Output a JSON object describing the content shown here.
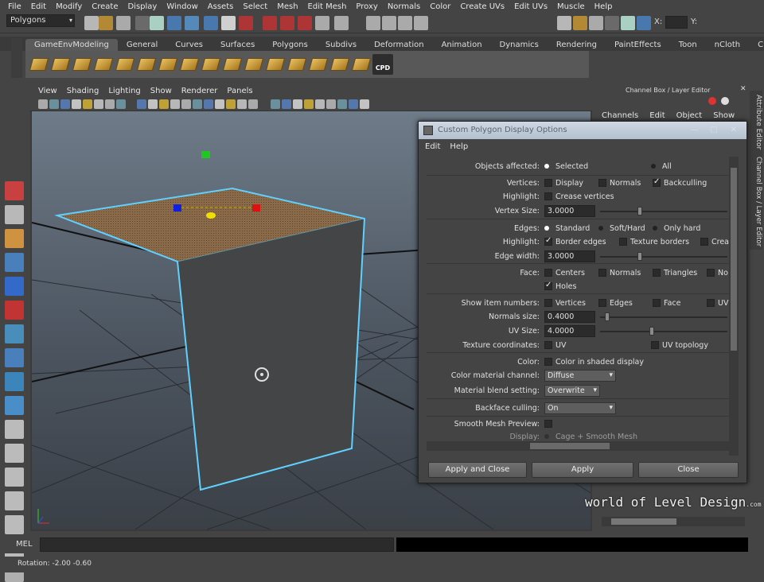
{
  "main_menu": [
    "File",
    "Edit",
    "Modify",
    "Create",
    "Display",
    "Window",
    "Assets",
    "Select",
    "Mesh",
    "Edit Mesh",
    "Proxy",
    "Normals",
    "Color",
    "Create UVs",
    "Edit UVs",
    "Muscle",
    "Help"
  ],
  "status_line": {
    "mode": "Polygons",
    "x_label": "X:",
    "y_label": "Y:"
  },
  "shelf_tabs": [
    {
      "label": "GameEnvModeling",
      "active": true
    },
    {
      "label": "General"
    },
    {
      "label": "Curves"
    },
    {
      "label": "Surfaces"
    },
    {
      "label": "Polygons"
    },
    {
      "label": "Subdivs"
    },
    {
      "label": "Deformation"
    },
    {
      "label": "Animation"
    },
    {
      "label": "Dynamics"
    },
    {
      "label": "Rendering"
    },
    {
      "label": "PaintEffects"
    },
    {
      "label": "Toon"
    },
    {
      "label": "nCloth"
    },
    {
      "label": "Custom"
    }
  ],
  "shelf": {
    "cpd_label": "CPD",
    "icons": [
      "extrude-icon",
      "bevel-icon",
      "merge-icon",
      "split-icon",
      "bridge-icon",
      "append-icon",
      "fill-hole-icon",
      "combine-icon",
      "separate-icon",
      "smooth-icon",
      "cone-icon",
      "plane-icon",
      "sphere-icon",
      "cube-icon",
      "cylinder-icon",
      "grid-icon"
    ]
  },
  "viewport_menu": [
    "View",
    "Shading",
    "Lighting",
    "Show",
    "Renderer",
    "Panels"
  ],
  "channel_box": {
    "title": "Channel Box / Layer Editor",
    "menu": [
      "Channels",
      "Edit",
      "Object",
      "Show"
    ]
  },
  "side_tabs": [
    "Attribute Editor",
    "Channel Box / Layer Editor"
  ],
  "dialog": {
    "title": "Custom Polygon Display Options",
    "menu": [
      "Edit",
      "Help"
    ],
    "objects_affected": {
      "label": "Objects affected:",
      "options": [
        {
          "text": "Selected",
          "on": true
        },
        {
          "text": "All",
          "on": false
        }
      ]
    },
    "vertices": {
      "label": "Vertices:",
      "options": [
        {
          "text": "Display",
          "on": false
        },
        {
          "text": "Normals",
          "on": false
        },
        {
          "text": "Backculling",
          "on": true
        }
      ]
    },
    "vert_highlight": {
      "label": "Highlight:",
      "options": [
        {
          "text": "Crease vertices",
          "on": false
        }
      ]
    },
    "vertex_size": {
      "label": "Vertex Size:",
      "value": "3.0000",
      "fraction": 0.3
    },
    "edges": {
      "label": "Edges:",
      "options": [
        {
          "text": "Standard",
          "on": true
        },
        {
          "text": "Soft/Hard",
          "on": false
        },
        {
          "text": "Only hard",
          "on": false
        }
      ]
    },
    "edge_highlight": {
      "label": "Highlight:",
      "options": [
        {
          "text": "Border edges",
          "on": true
        },
        {
          "text": "Texture borders",
          "on": false
        },
        {
          "text": "Crea",
          "on": false
        }
      ]
    },
    "edge_width": {
      "label": "Edge width:",
      "value": "3.0000",
      "fraction": 0.3
    },
    "face": {
      "label": "Face:",
      "options": [
        {
          "text": "Centers",
          "on": false
        },
        {
          "text": "Normals",
          "on": false
        },
        {
          "text": "Triangles",
          "on": false
        },
        {
          "text": "No",
          "on": false
        }
      ]
    },
    "face2": {
      "options": [
        {
          "text": "Holes",
          "on": true
        }
      ]
    },
    "show_item_numbers": {
      "label": "Show item numbers:",
      "options": [
        {
          "text": "Vertices",
          "on": false
        },
        {
          "text": "Edges",
          "on": false
        },
        {
          "text": "Face",
          "on": false
        },
        {
          "text": "UV",
          "on": false
        }
      ]
    },
    "normals_size": {
      "label": "Normals size:",
      "value": "0.4000",
      "fraction": 0.04
    },
    "uv_size": {
      "label": "UV Size:",
      "value": "4.0000",
      "fraction": 0.4
    },
    "texture_coordinates": {
      "label": "Texture coordinates:",
      "options": [
        {
          "text": "UV",
          "on": false
        },
        {
          "text": "UV topology",
          "on": false
        }
      ]
    },
    "color": {
      "label": "Color:",
      "options": [
        {
          "text": "Color in shaded display",
          "on": false
        }
      ]
    },
    "color_material_channel": {
      "label": "Color material channel:",
      "value": "Diffuse"
    },
    "material_blend_setting": {
      "label": "Material blend setting:",
      "value": "Overwrite"
    },
    "backface_culling": {
      "label": "Backface culling:",
      "value": "On"
    },
    "smooth_mesh_preview": {
      "label": "Smooth Mesh Preview:"
    },
    "display": {
      "label": "Display:",
      "value": "Cage + Smooth Mesh"
    },
    "buttons": {
      "apply_close": "Apply and Close",
      "apply": "Apply",
      "close": "Close"
    }
  },
  "mel": {
    "label": "MEL"
  },
  "help_line": "Rotation:  -2.00     -0.60",
  "watermark": {
    "text": "world of Level Design",
    "suffix": ".com"
  },
  "colors": {
    "selection_edge": "#5fd0ff",
    "dialog_title_bg": "#c4cfdc",
    "manip_green": "#1ec81e",
    "manip_red": "#e01010",
    "manip_blue": "#1020e0",
    "manip_yellow": "#f0e000"
  }
}
